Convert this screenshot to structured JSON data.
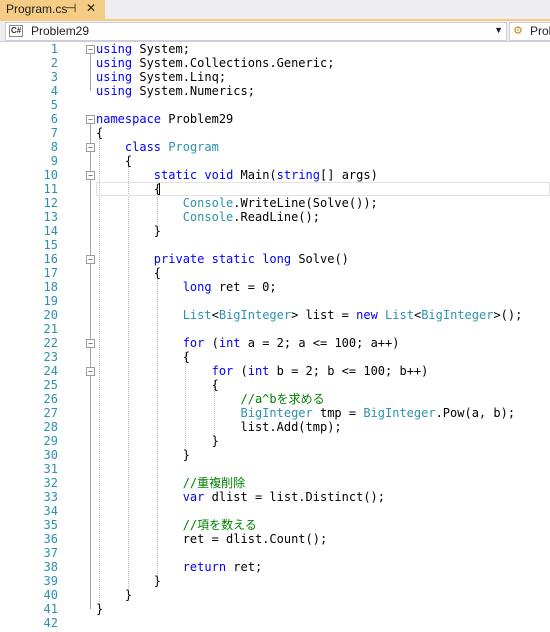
{
  "tab": {
    "title": "Program.cs",
    "pin_glyph": "⊣",
    "close_glyph": "✕"
  },
  "navbar": {
    "left_label": "Problem29",
    "left_icon": "C#",
    "right_label": "Prob"
  },
  "editor": {
    "lines": [
      {
        "n": "1",
        "segs": [
          [
            "using",
            "kw"
          ],
          [
            " System;",
            ""
          ]
        ]
      },
      {
        "n": "2",
        "segs": [
          [
            "using",
            "kw"
          ],
          [
            " System.Collections.Generic;",
            ""
          ]
        ]
      },
      {
        "n": "3",
        "segs": [
          [
            "using",
            "kw"
          ],
          [
            " System.Linq;",
            ""
          ]
        ]
      },
      {
        "n": "4",
        "segs": [
          [
            "using",
            "kw"
          ],
          [
            " System.Numerics;",
            ""
          ]
        ]
      },
      {
        "n": "5",
        "segs": []
      },
      {
        "n": "6",
        "segs": [
          [
            "namespace",
            "kw"
          ],
          [
            " Problem29",
            ""
          ]
        ]
      },
      {
        "n": "7",
        "segs": [
          [
            "{",
            ""
          ]
        ]
      },
      {
        "n": "8",
        "segs": [
          [
            "    ",
            ""
          ],
          [
            "class",
            "kw"
          ],
          [
            " ",
            ""
          ],
          [
            "Program",
            "ty"
          ]
        ]
      },
      {
        "n": "9",
        "segs": [
          [
            "    {",
            ""
          ]
        ]
      },
      {
        "n": "10",
        "segs": [
          [
            "        ",
            ""
          ],
          [
            "static",
            "kw"
          ],
          [
            " ",
            ""
          ],
          [
            "void",
            "kw"
          ],
          [
            " Main(",
            ""
          ],
          [
            "string",
            "kw"
          ],
          [
            "[] args)",
            ""
          ]
        ]
      },
      {
        "n": "11",
        "segs": [
          [
            "        {",
            ""
          ]
        ]
      },
      {
        "n": "12",
        "segs": [
          [
            "            ",
            ""
          ],
          [
            "Console",
            "ty"
          ],
          [
            ".WriteLine(Solve());",
            ""
          ]
        ]
      },
      {
        "n": "13",
        "segs": [
          [
            "            ",
            ""
          ],
          [
            "Console",
            "ty"
          ],
          [
            ".ReadLine();",
            ""
          ]
        ]
      },
      {
        "n": "14",
        "segs": [
          [
            "        }",
            ""
          ]
        ]
      },
      {
        "n": "15",
        "segs": []
      },
      {
        "n": "16",
        "segs": [
          [
            "        ",
            ""
          ],
          [
            "private",
            "kw"
          ],
          [
            " ",
            ""
          ],
          [
            "static",
            "kw"
          ],
          [
            " ",
            ""
          ],
          [
            "long",
            "kw"
          ],
          [
            " Solve()",
            ""
          ]
        ]
      },
      {
        "n": "17",
        "segs": [
          [
            "        {",
            ""
          ]
        ]
      },
      {
        "n": "18",
        "segs": [
          [
            "            ",
            ""
          ],
          [
            "long",
            "kw"
          ],
          [
            " ret = 0;",
            ""
          ]
        ]
      },
      {
        "n": "19",
        "segs": []
      },
      {
        "n": "20",
        "segs": [
          [
            "            ",
            ""
          ],
          [
            "List",
            "ty"
          ],
          [
            "<",
            ""
          ],
          [
            "BigInteger",
            "ty"
          ],
          [
            "> list = ",
            ""
          ],
          [
            "new",
            "kw"
          ],
          [
            " ",
            ""
          ],
          [
            "List",
            "ty"
          ],
          [
            "<",
            ""
          ],
          [
            "BigInteger",
            "ty"
          ],
          [
            ">();",
            ""
          ]
        ]
      },
      {
        "n": "21",
        "segs": []
      },
      {
        "n": "22",
        "segs": [
          [
            "            ",
            ""
          ],
          [
            "for",
            "kw"
          ],
          [
            " (",
            ""
          ],
          [
            "int",
            "kw"
          ],
          [
            " a = 2; a <= 100; a++)",
            ""
          ]
        ]
      },
      {
        "n": "23",
        "segs": [
          [
            "            {",
            ""
          ]
        ]
      },
      {
        "n": "24",
        "segs": [
          [
            "                ",
            ""
          ],
          [
            "for",
            "kw"
          ],
          [
            " (",
            ""
          ],
          [
            "int",
            "kw"
          ],
          [
            " b = 2; b <= 100; b++)",
            ""
          ]
        ]
      },
      {
        "n": "25",
        "segs": [
          [
            "                {",
            ""
          ]
        ]
      },
      {
        "n": "26",
        "segs": [
          [
            "                    ",
            ""
          ],
          [
            "//a^bを求める",
            "cm"
          ]
        ]
      },
      {
        "n": "27",
        "segs": [
          [
            "                    ",
            ""
          ],
          [
            "BigInteger",
            "ty"
          ],
          [
            " tmp = ",
            ""
          ],
          [
            "BigInteger",
            "ty"
          ],
          [
            ".Pow(a, b);",
            ""
          ]
        ]
      },
      {
        "n": "28",
        "segs": [
          [
            "                    list.Add(tmp);",
            ""
          ]
        ]
      },
      {
        "n": "29",
        "segs": [
          [
            "                }",
            ""
          ]
        ]
      },
      {
        "n": "30",
        "segs": [
          [
            "            }",
            ""
          ]
        ]
      },
      {
        "n": "31",
        "segs": []
      },
      {
        "n": "32",
        "segs": [
          [
            "            ",
            ""
          ],
          [
            "//重複削除",
            "cm"
          ]
        ]
      },
      {
        "n": "33",
        "segs": [
          [
            "            ",
            ""
          ],
          [
            "var",
            "kw"
          ],
          [
            " dlist = list.Distinct();",
            ""
          ]
        ]
      },
      {
        "n": "34",
        "segs": []
      },
      {
        "n": "35",
        "segs": [
          [
            "            ",
            ""
          ],
          [
            "//項を数える",
            "cm"
          ]
        ]
      },
      {
        "n": "36",
        "segs": [
          [
            "            ret = dlist.Count();",
            ""
          ]
        ]
      },
      {
        "n": "37",
        "segs": []
      },
      {
        "n": "38",
        "segs": [
          [
            "            ",
            ""
          ],
          [
            "return",
            "kw"
          ],
          [
            " ret;",
            ""
          ]
        ]
      },
      {
        "n": "39",
        "segs": [
          [
            "        }",
            ""
          ]
        ]
      },
      {
        "n": "40",
        "segs": [
          [
            "    }",
            ""
          ]
        ]
      },
      {
        "n": "41",
        "segs": [
          [
            "}",
            ""
          ]
        ]
      },
      {
        "n": "42",
        "segs": []
      }
    ]
  },
  "colors": {
    "keyword": "#0000ff",
    "type": "#2b91af",
    "comment": "#008000",
    "line_number": "#2b91af",
    "tab_active": "#f5cc84"
  }
}
